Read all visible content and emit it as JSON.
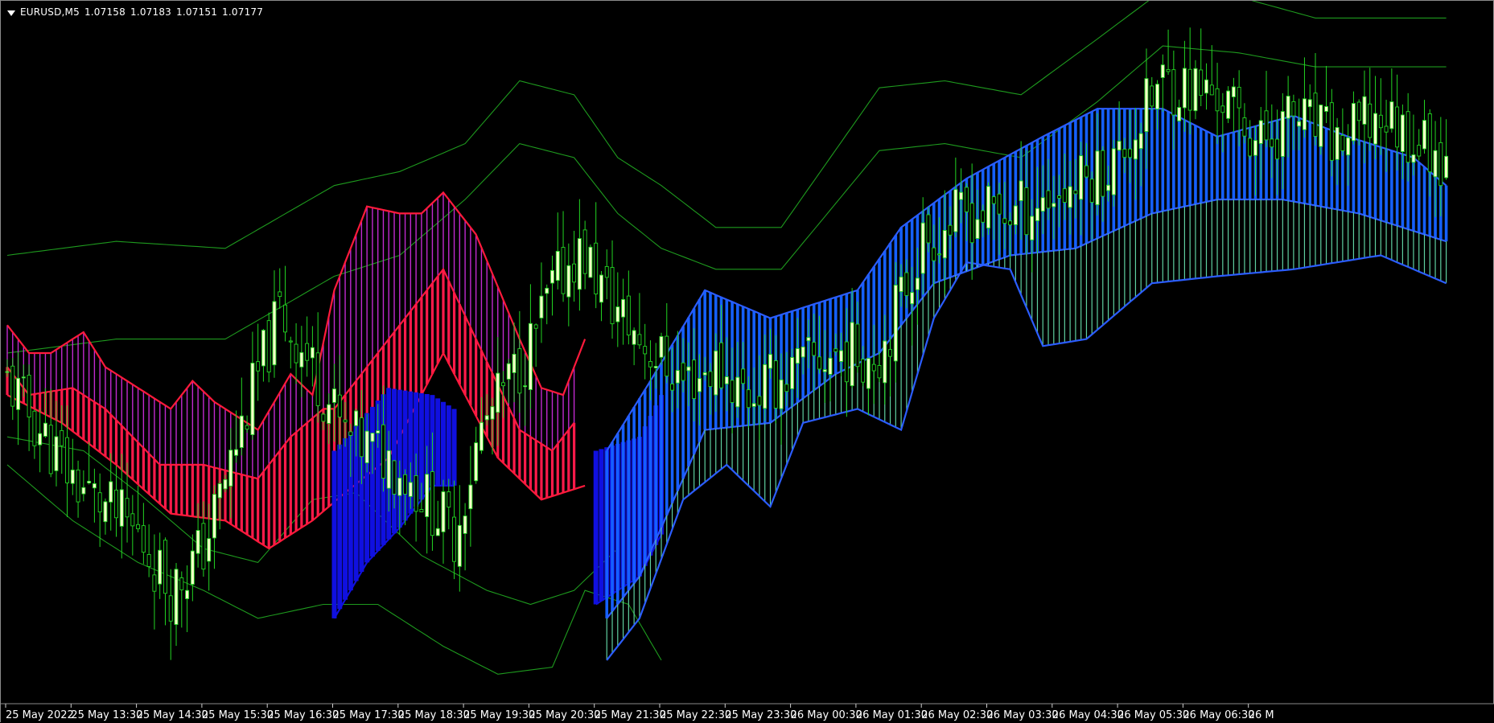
{
  "header": {
    "symbol_label": "EURUSD,M5",
    "open": "1.07158",
    "high": "1.07183",
    "low": "1.07151",
    "close": "1.07177"
  },
  "colors": {
    "background": "#000000",
    "bull_candle": "#f5ffc8",
    "bear_candle": "#000000",
    "wick": "#22d422",
    "channel_line": "#1e9a1e",
    "bear_cloud_edge": "#ff1a3c",
    "bear_cloud_fill": "#ff1a4a",
    "bear_upper_fill": "#c12acf",
    "bull_cloud_edge": "#2b5dff",
    "bull_cloud_fill": "#1560ff",
    "bull_dark_fill": "#1010e0",
    "bull_lower_fill": "#5fd0a0",
    "axis_text": "#ffffff"
  },
  "chart_data": {
    "type": "candlestick",
    "symbol": "EURUSD",
    "timeframe": "M5",
    "x_tick_labels": [
      "25 May 2022",
      "25 May 13:30",
      "25 May 14:30",
      "25 May 15:30",
      "25 May 16:30",
      "25 May 17:30",
      "25 May 18:30",
      "25 May 19:30",
      "25 May 20:30",
      "25 May 21:30",
      "25 May 22:30",
      "25 May 23:30",
      "26 May 00:30",
      "26 May 01:30",
      "26 May 02:30",
      "26 May 03:30",
      "26 May 04:30",
      "26 May 05:30",
      "26 May 06:30",
      "26 M"
    ],
    "candles_per_tick": 12,
    "ylim": [
      1.0638,
      1.0738
    ],
    "close_path": [
      [
        0,
        1.0684
      ],
      [
        12,
        1.067
      ],
      [
        24,
        1.0662
      ],
      [
        30,
        1.0654
      ],
      [
        36,
        1.066
      ],
      [
        44,
        1.068
      ],
      [
        50,
        1.0694
      ],
      [
        56,
        1.0686
      ],
      [
        62,
        1.0676
      ],
      [
        70,
        1.0673
      ],
      [
        76,
        1.0668
      ],
      [
        82,
        1.0662
      ],
      [
        87,
        1.0677
      ],
      [
        96,
        1.0689
      ],
      [
        100,
        1.0697
      ],
      [
        104,
        1.0702
      ],
      [
        106,
        1.0702
      ],
      [
        110,
        1.0696
      ],
      [
        116,
        1.069
      ],
      [
        124,
        1.0684
      ],
      [
        130,
        1.0686
      ],
      [
        136,
        1.0682
      ],
      [
        146,
        1.0686
      ],
      [
        152,
        1.0688
      ],
      [
        160,
        1.0688
      ],
      [
        168,
        1.0704
      ],
      [
        176,
        1.0708
      ],
      [
        184,
        1.0708
      ],
      [
        196,
        1.0712
      ],
      [
        204,
        1.0716
      ],
      [
        212,
        1.0727
      ],
      [
        222,
        1.0725
      ],
      [
        230,
        1.0718
      ],
      [
        236,
        1.0722
      ],
      [
        244,
        1.0718
      ],
      [
        252,
        1.0722
      ],
      [
        264,
        1.0716
      ]
    ],
    "channel_upper_outer": [
      [
        0,
        1.0702
      ],
      [
        20,
        1.0704
      ],
      [
        40,
        1.0703
      ],
      [
        60,
        1.0712
      ],
      [
        72,
        1.0714
      ],
      [
        84,
        1.0718
      ],
      [
        94,
        1.0727
      ],
      [
        104,
        1.0725
      ],
      [
        112,
        1.0716
      ],
      [
        120,
        1.0712
      ],
      [
        130,
        1.0706
      ],
      [
        142,
        1.0706
      ],
      [
        160,
        1.0726
      ],
      [
        172,
        1.0727
      ],
      [
        186,
        1.0725
      ],
      [
        200,
        1.0733
      ],
      [
        212,
        1.074
      ],
      [
        226,
        1.0739
      ],
      [
        240,
        1.0736
      ],
      [
        264,
        1.0736
      ]
    ],
    "channel_upper_inner": [
      [
        0,
        1.0688
      ],
      [
        20,
        1.069
      ],
      [
        40,
        1.069
      ],
      [
        60,
        1.0699
      ],
      [
        72,
        1.0702
      ],
      [
        84,
        1.071
      ],
      [
        94,
        1.0718
      ],
      [
        104,
        1.0716
      ],
      [
        112,
        1.0708
      ],
      [
        120,
        1.0703
      ],
      [
        130,
        1.07
      ],
      [
        142,
        1.07
      ],
      [
        160,
        1.0717
      ],
      [
        172,
        1.0718
      ],
      [
        186,
        1.0716
      ],
      [
        200,
        1.0724
      ],
      [
        212,
        1.0732
      ],
      [
        226,
        1.0731
      ],
      [
        240,
        1.0729
      ],
      [
        264,
        1.0729
      ]
    ],
    "channel_lower_inner": [
      [
        0,
        1.0676
      ],
      [
        14,
        1.0674
      ],
      [
        24,
        1.0668
      ],
      [
        36,
        1.066
      ],
      [
        46,
        1.0658
      ],
      [
        56,
        1.0667
      ],
      [
        64,
        1.0668
      ],
      [
        76,
        1.0659
      ],
      [
        88,
        1.0654
      ],
      [
        96,
        1.0652
      ],
      [
        104,
        1.0654
      ],
      [
        112,
        1.066
      ]
    ],
    "channel_lower_outer": [
      [
        0,
        1.0672
      ],
      [
        12,
        1.0664
      ],
      [
        24,
        1.0658
      ],
      [
        36,
        1.0654
      ],
      [
        46,
        1.065
      ],
      [
        58,
        1.0652
      ],
      [
        68,
        1.0652
      ],
      [
        80,
        1.0646
      ],
      [
        90,
        1.0642
      ],
      [
        100,
        1.0643
      ],
      [
        106,
        1.0654
      ],
      [
        114,
        1.0652
      ],
      [
        120,
        1.0644
      ]
    ],
    "bear_cloud_top": [
      [
        0,
        1.0692
      ],
      [
        4,
        1.0688
      ],
      [
        8,
        1.0688
      ],
      [
        14,
        1.0691
      ],
      [
        18,
        1.0686
      ],
      [
        30,
        1.068
      ],
      [
        34,
        1.0684
      ],
      [
        38,
        1.0681
      ],
      [
        46,
        1.0677
      ],
      [
        52,
        1.0685
      ],
      [
        56,
        1.0682
      ],
      [
        60,
        1.0697
      ],
      [
        66,
        1.0709
      ],
      [
        72,
        1.0708
      ],
      [
        76,
        1.0708
      ],
      [
        80,
        1.0711
      ],
      [
        86,
        1.0705
      ],
      [
        94,
        1.069
      ],
      [
        98,
        1.0683
      ],
      [
        102,
        1.0682
      ],
      [
        106,
        1.069
      ]
    ],
    "bear_cloud_mid": [
      [
        0,
        1.0686
      ],
      [
        4,
        1.0682
      ],
      [
        12,
        1.0683
      ],
      [
        18,
        1.068
      ],
      [
        28,
        1.0672
      ],
      [
        36,
        1.0672
      ],
      [
        46,
        1.067
      ],
      [
        52,
        1.0676
      ],
      [
        58,
        1.068
      ],
      [
        60,
        1.068
      ],
      [
        80,
        1.07
      ],
      [
        86,
        1.069
      ],
      [
        94,
        1.0677
      ],
      [
        100,
        1.0674
      ],
      [
        104,
        1.0678
      ]
    ],
    "bear_cloud_bottom": [
      [
        0,
        1.0682
      ],
      [
        10,
        1.0678
      ],
      [
        20,
        1.0672
      ],
      [
        30,
        1.0665
      ],
      [
        40,
        1.0664
      ],
      [
        48,
        1.066
      ],
      [
        56,
        1.0664
      ],
      [
        62,
        1.0668
      ],
      [
        70,
        1.0673
      ],
      [
        80,
        1.0688
      ],
      [
        90,
        1.0673
      ],
      [
        98,
        1.0667
      ],
      [
        106,
        1.0669
      ]
    ],
    "bull_dark_cloud": {
      "top": [
        [
          60,
          1.0674
        ],
        [
          70,
          1.0683
        ],
        [
          78,
          1.0682
        ],
        [
          82,
          1.068
        ]
      ],
      "bottom": [
        [
          60,
          1.065
        ],
        [
          66,
          1.0658
        ],
        [
          72,
          1.0663
        ],
        [
          78,
          1.0669
        ],
        [
          82,
          1.0669
        ]
      ]
    },
    "bull_dark_cloud_2": {
      "top": [
        [
          108,
          1.0674
        ],
        [
          116,
          1.0676
        ],
        [
          120,
          1.0682
        ]
      ],
      "bottom": [
        [
          108,
          1.0652
        ],
        [
          112,
          1.0654
        ],
        [
          116,
          1.0656
        ],
        [
          120,
          1.0662
        ]
      ]
    },
    "bull_cloud_top": [
      [
        110,
        1.0674
      ],
      [
        118,
        1.0684
      ],
      [
        128,
        1.0697
      ],
      [
        140,
        1.0693
      ],
      [
        156,
        1.0697
      ],
      [
        164,
        1.0706
      ],
      [
        176,
        1.0713
      ],
      [
        190,
        1.0719
      ],
      [
        200,
        1.0723
      ],
      [
        212,
        1.0723
      ],
      [
        222,
        1.0719
      ],
      [
        236,
        1.0722
      ],
      [
        246,
        1.0719
      ],
      [
        258,
        1.0716
      ],
      [
        264,
        1.0712
      ]
    ],
    "bull_cloud_bottom": [
      [
        110,
        1.065
      ],
      [
        116,
        1.0656
      ],
      [
        128,
        1.0677
      ],
      [
        140,
        1.0678
      ],
      [
        152,
        1.0685
      ],
      [
        160,
        1.0688
      ],
      [
        170,
        1.0698
      ],
      [
        184,
        1.0702
      ],
      [
        196,
        1.0703
      ],
      [
        210,
        1.0708
      ],
      [
        222,
        1.071
      ],
      [
        234,
        1.071
      ],
      [
        248,
        1.0708
      ],
      [
        264,
        1.0704
      ]
    ],
    "bull_cloud_lower": [
      [
        110,
        1.0644
      ],
      [
        116,
        1.065
      ],
      [
        124,
        1.0667
      ],
      [
        132,
        1.0672
      ],
      [
        140,
        1.0666
      ],
      [
        146,
        1.0678
      ],
      [
        156,
        1.068
      ],
      [
        164,
        1.0677
      ],
      [
        170,
        1.0693
      ],
      [
        176,
        1.0701
      ],
      [
        184,
        1.07
      ],
      [
        190,
        1.0689
      ],
      [
        198,
        1.069
      ],
      [
        210,
        1.0698
      ],
      [
        222,
        1.0699
      ],
      [
        236,
        1.07
      ],
      [
        252,
        1.0702
      ],
      [
        264,
        1.0698
      ]
    ]
  }
}
